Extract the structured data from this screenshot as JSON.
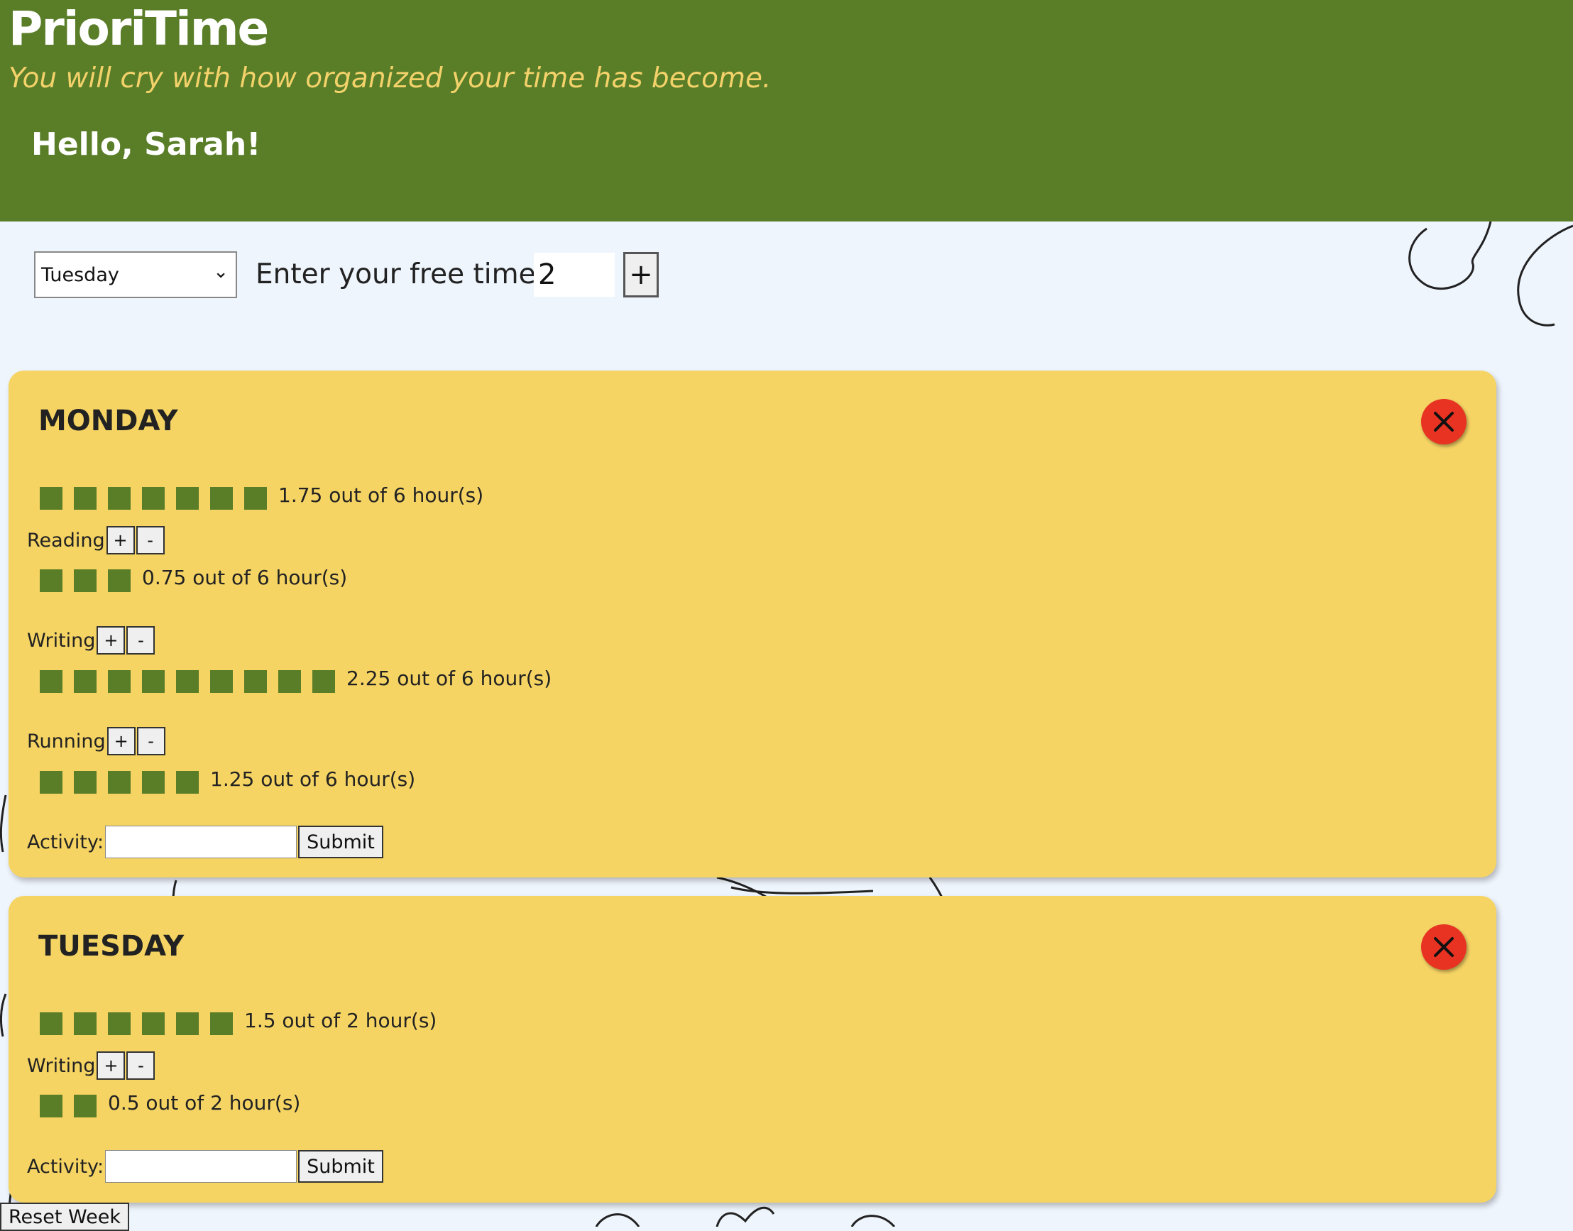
{
  "header": {
    "title": "PrioriTime",
    "tagline": "You will cry with how organized your time has become.",
    "greeting": "Hello, Sarah!"
  },
  "controls": {
    "day_selected": "Tuesday",
    "free_time_label": "Enter your free time:",
    "free_time_value": "2",
    "add_label": "+"
  },
  "colors": {
    "header_bg": "#5a7d28",
    "tagline": "#f3d26a",
    "card_bg": "#f5d464",
    "progress_square": "#5a7d28",
    "close_button": "#e83323",
    "page_bg": "#eff5fd"
  },
  "days": [
    {
      "name": "MONDAY",
      "total": {
        "squares": 7,
        "text": "1.75 out of 6 hour(s)"
      },
      "activities": [
        {
          "label": "Reading",
          "squares": 3,
          "text": "0.75 out of 6 hour(s)"
        },
        {
          "label": "Writing",
          "squares": 9,
          "text": "2.25 out of 6 hour(s)"
        },
        {
          "label": "Running",
          "squares": 5,
          "text": "1.25 out of 6 hour(s)"
        }
      ],
      "activity_label": "Activity:",
      "submit_label": "Submit"
    },
    {
      "name": "TUESDAY",
      "total": {
        "squares": 6,
        "text": "1.5 out of 2 hour(s)"
      },
      "activities": [
        {
          "label": "Writing",
          "squares": 2,
          "text": "0.5 out of 2 hour(s)"
        }
      ],
      "activity_label": "Activity:",
      "submit_label": "Submit"
    }
  ],
  "buttons": {
    "plus": "+",
    "minus": "-",
    "reset_week": "Reset Week"
  },
  "icons": {
    "close": "close-icon",
    "dropdown": "chevron-down-icon"
  }
}
